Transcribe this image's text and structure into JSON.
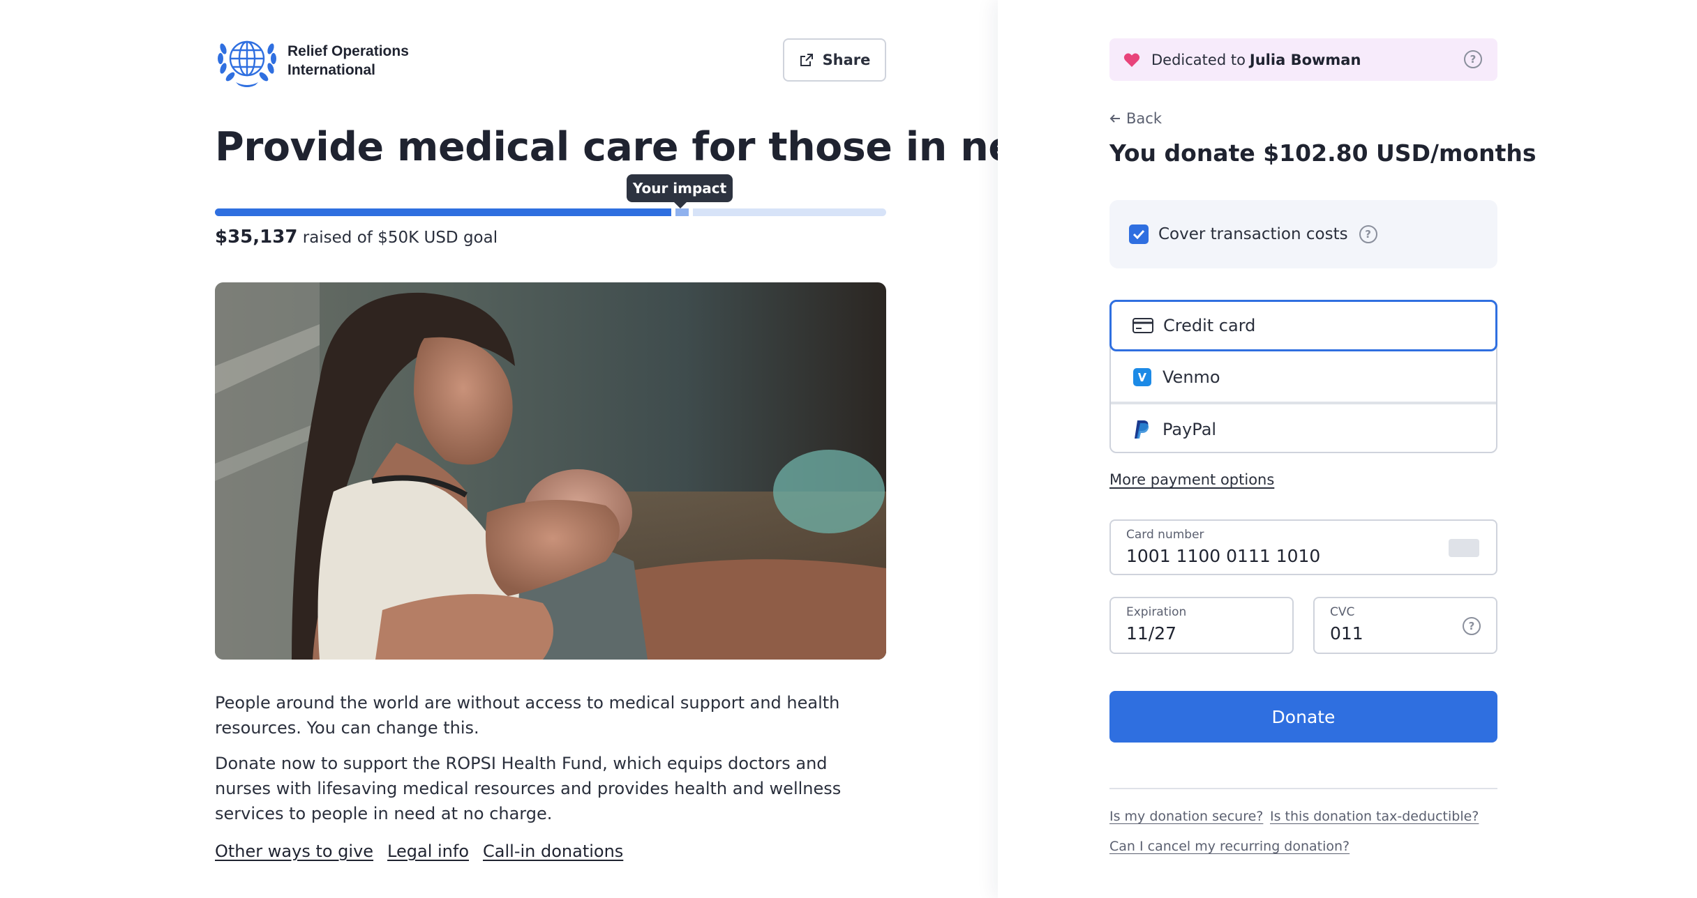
{
  "org": {
    "name_line1": "Relief Operations",
    "name_line2": "International"
  },
  "header": {
    "share_label": "Share"
  },
  "campaign": {
    "title": "Provide medical care for those in need",
    "tooltip": "Your impact",
    "raised_amount": "$35,137",
    "raised_suffix": "raised of $50K USD goal",
    "progress_fraction": 0.68,
    "impact_fraction": 0.02,
    "description_1": "People around the world are without access to medical support and health resources. You can change this.",
    "description_2": "Donate now to support the ROPSI Health Fund, which equips doctors and nurses with lifesaving medical resources and provides health and wellness services to people in need at no charge.",
    "links": [
      "Other ways to give",
      "Legal info",
      "Call-in donations"
    ]
  },
  "donation": {
    "dedicated_prefix": "Dedicated to",
    "dedicated_name": "Julia Bowman",
    "back_label": "Back",
    "summary": "You donate $102.80 USD/months",
    "cover_label": "Cover transaction costs",
    "cover_checked": true,
    "payment_options": [
      "Credit card",
      "Venmo",
      "PayPal"
    ],
    "selected_payment": "Credit card",
    "more_payment": "More payment options",
    "card_number_label": "Card number",
    "card_number_value": "1001 1100 0111 1010",
    "expiration_label": "Expiration",
    "expiration_value": "11/27",
    "cvc_label": "CVC",
    "cvc_value": "011",
    "donate_label": "Donate",
    "faq": [
      "Is my donation secure?",
      "Is this donation tax-deductible?",
      "Can I cancel my recurring donation?"
    ]
  },
  "colors": {
    "accent": "#2f6fe0",
    "dedicated_bg": "#f7ebfb",
    "heart": "#e8437a",
    "text": "#1f2330"
  },
  "icons": [
    "globe-wreath-logo",
    "share-icon",
    "heart-icon",
    "help-icon",
    "arrow-left-icon",
    "checkmark-icon",
    "credit-card-icon",
    "venmo-icon",
    "paypal-icon",
    "card-brand-icon"
  ]
}
